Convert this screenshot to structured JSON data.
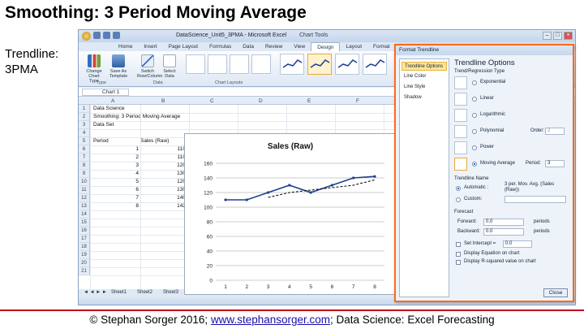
{
  "slide": {
    "title": "Smoothing: 3 Period Moving Average",
    "side_label_line1": "Trendline:",
    "side_label_line2": "3PMA",
    "footer_before": "© Stephan Sorger 2016; ",
    "footer_link": "www.stephansorger.com",
    "footer_after": "; Data Science: Excel Forecasting",
    "accent": "#c0001e"
  },
  "excel": {
    "window_title": "DataScience_Unit5_3PMA - Microsoft Excel",
    "context_tools": "Chart Tools",
    "tabs": [
      "Home",
      "Insert",
      "Page Layout",
      "Formulas",
      "Data",
      "Review",
      "View",
      "Design",
      "Layout",
      "Format"
    ],
    "ribbon": {
      "change_chart_type": "Change Chart Type",
      "save_as_template": "Save As Template",
      "switch_row_column": "Switch Row/Column",
      "select_data": "Select Data",
      "group_type": "Type",
      "group_data": "Data",
      "group_layouts": "Chart Layouts"
    },
    "name_box": "Chart 1",
    "columns": [
      "A",
      "B",
      "C",
      "D",
      "E",
      "F",
      "G",
      "H",
      "I"
    ],
    "rows": [
      "1",
      "2",
      "3",
      "4",
      "5",
      "6",
      "7",
      "8",
      "9",
      "10",
      "11",
      "12",
      "13",
      "14",
      "15",
      "16",
      "17",
      "18",
      "19",
      "20",
      "21"
    ],
    "cells": {
      "a1": "Data Science",
      "a2": "Smoothing: 3 Period Moving Average",
      "a3": "Data Set",
      "a5": "Period",
      "b5": "Sales (Raw)"
    },
    "periods": [
      "1",
      "2",
      "3",
      "4",
      "5",
      "6",
      "7",
      "8"
    ],
    "sales": [
      "110",
      "110",
      "120",
      "130",
      "120",
      "130",
      "140",
      "142"
    ],
    "sheet_tabs": [
      "Sheet1",
      "Sheet2",
      "Sheet3"
    ]
  },
  "chart_data": {
    "type": "line",
    "title": "Sales (Raw)",
    "categories": [
      "1",
      "2",
      "3",
      "4",
      "5",
      "6",
      "7",
      "8"
    ],
    "series": [
      {
        "values": [
          110,
          110,
          120,
          130,
          120,
          130,
          140,
          142
        ],
        "color": "#1f3f8f"
      },
      {
        "values": [
          null,
          null,
          113.3,
          120,
          123.3,
          126.7,
          130,
          137.3
        ],
        "color": "#000000",
        "dashed": true
      }
    ],
    "ylim": [
      0,
      150
    ],
    "yticks": [
      "0",
      "20",
      "40",
      "60",
      "80",
      "100",
      "120",
      "140",
      "160"
    ],
    "grid": true
  },
  "dialog": {
    "title": "Format Trendline",
    "nav": [
      "Trendline Options",
      "Line Color",
      "Line Style",
      "Shadow"
    ],
    "heading": "Trendline Options",
    "section_type": "Trend/Regression Type",
    "types": [
      "Exponential",
      "Linear",
      "Logarithmic",
      "Polynomial",
      "Power",
      "Moving Average"
    ],
    "order_label": "Order:",
    "order_value": "2",
    "period_label": "Period:",
    "period_value": "3",
    "section_name": "Trendline Name",
    "automatic": "Automatic :",
    "auto_name": "3 per. Mov. Avg. (Sales (Raw))",
    "custom": "Custom:",
    "section_forecast": "Forecast",
    "forward": "Forward:",
    "forward_value": "0.0",
    "backward": "Backward:",
    "backward_value": "0.0",
    "periods_unit": "periods",
    "set_intercept": "Set Intercept =",
    "intercept_value": "0.0",
    "display_equation": "Display Equation on chart",
    "display_r2": "Display R-squared value on chart",
    "close": "Close"
  }
}
